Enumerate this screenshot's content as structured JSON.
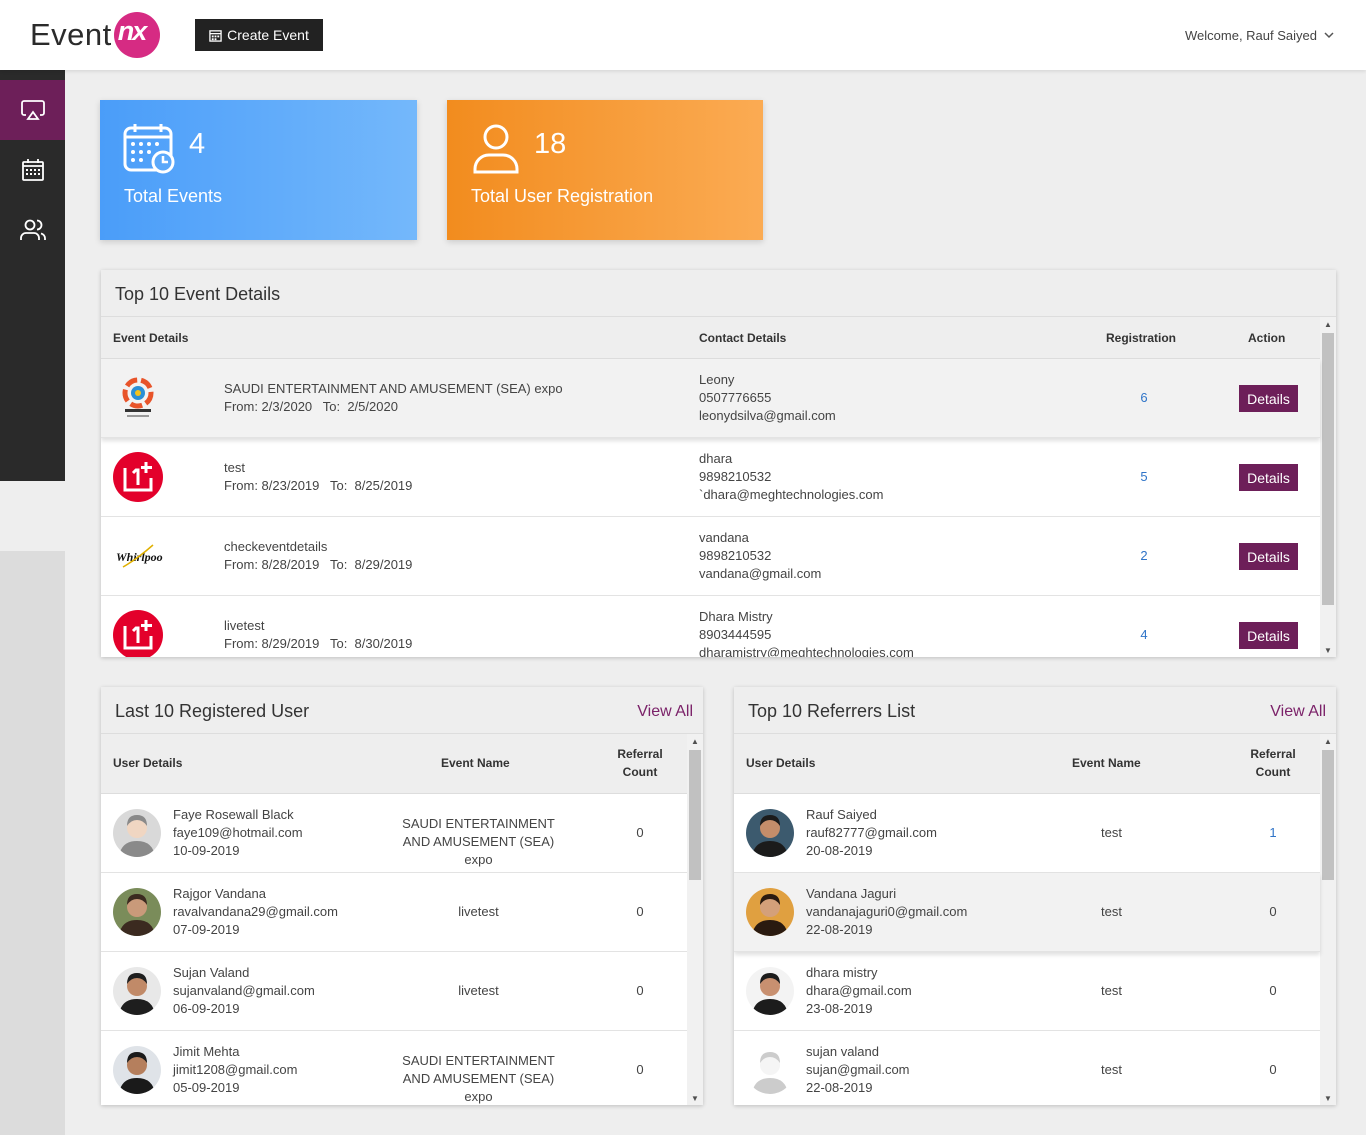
{
  "header": {
    "logo_text": "Event",
    "logo_accent": "nx",
    "create_event": "Create Event",
    "welcome": "Welcome, Rauf Saiyed"
  },
  "sidebar": {
    "items": [
      {
        "icon": "airplay-icon",
        "active": true
      },
      {
        "icon": "calendar-icon",
        "active": false
      },
      {
        "icon": "users-icon",
        "active": false
      }
    ]
  },
  "stats": [
    {
      "value": "4",
      "label": "Total Events",
      "icon": "calendar-clock-icon",
      "colors": [
        "#4a9df9",
        "#74b8fb"
      ]
    },
    {
      "value": "18",
      "label": "Total User Registration",
      "icon": "user-icon",
      "colors": [
        "#f28c1e",
        "#fbab53"
      ]
    }
  ],
  "events": {
    "title": "Top 10 Event Details",
    "columns": {
      "details": "Event Details",
      "contact": "Contact Details",
      "registration": "Registration",
      "action": "Action"
    },
    "details_label": "Details",
    "rows": [
      {
        "logo": "saudi-logo",
        "name": "SAUDI ENTERTAINMENT AND AMUSEMENT (SEA) expo",
        "dates": "From: 2/3/2020   To:  2/5/2020",
        "contact_name": "Leony",
        "phone": "0507776655",
        "email": "leonydsilva@gmail.com",
        "registrations": "6"
      },
      {
        "logo": "oneplus-logo",
        "name": "test",
        "dates": "From: 8/23/2019   To:  8/25/2019",
        "contact_name": "dhara",
        "phone": "9898210532",
        "email": "`dhara@meghtechnologies.com",
        "registrations": "5"
      },
      {
        "logo": "whirlpool-logo",
        "name": "checkeventdetails",
        "dates": "From: 8/28/2019   To:  8/29/2019",
        "contact_name": "vandana",
        "phone": "9898210532",
        "email": "vandana@gmail.com",
        "registrations": "2"
      },
      {
        "logo": "oneplus-logo",
        "name": "livetest",
        "dates": "From: 8/29/2019   To:  8/30/2019",
        "contact_name": "Dhara Mistry",
        "phone": "8903444595",
        "email": "dharamistry@meghtechnologies.com",
        "registrations": "4"
      }
    ]
  },
  "registered": {
    "title": "Last 10 Registered User",
    "view_all": "View All",
    "columns": {
      "user": "User Details",
      "event": "Event Name",
      "count": "Referral Count"
    },
    "rows": [
      {
        "name": "Faye Rosewall Black",
        "email": "faye109@hotmail.com",
        "date": "10-09-2019",
        "event": "SAUDI ENTERTAINMENT AND AMUSEMENT (SEA) expo",
        "count": "0"
      },
      {
        "name": "Rajgor Vandana",
        "email": "ravalvandana29@gmail.com",
        "date": "07-09-2019",
        "event": "livetest",
        "count": "0"
      },
      {
        "name": "Sujan Valand",
        "email": "sujanvaland@gmail.com",
        "date": "06-09-2019",
        "event": "livetest",
        "count": "0"
      },
      {
        "name": "Jimit Mehta",
        "email": "jimit1208@gmail.com",
        "date": "05-09-2019",
        "event": "SAUDI ENTERTAINMENT AND AMUSEMENT (SEA) expo",
        "count": "0"
      }
    ]
  },
  "referrers": {
    "title": "Top 10 Referrers List",
    "view_all": "View All",
    "columns": {
      "user": "User Details",
      "event": "Event Name",
      "count": "Referral Count"
    },
    "rows": [
      {
        "name": "Rauf Saiyed",
        "email": "rauf82777@gmail.com",
        "date": "20-08-2019",
        "event": "test",
        "count": "1"
      },
      {
        "name": "Vandana Jaguri",
        "email": "vandanajaguri0@gmail.com",
        "date": "22-08-2019",
        "event": "test",
        "count": "0"
      },
      {
        "name": "dhara mistry",
        "email": "dhara@gmail.com",
        "date": "23-08-2019",
        "event": "test",
        "count": "0"
      },
      {
        "name": "sujan valand",
        "email": "sujan@gmail.com",
        "date": "22-08-2019",
        "event": "test",
        "count": "0"
      }
    ]
  }
}
